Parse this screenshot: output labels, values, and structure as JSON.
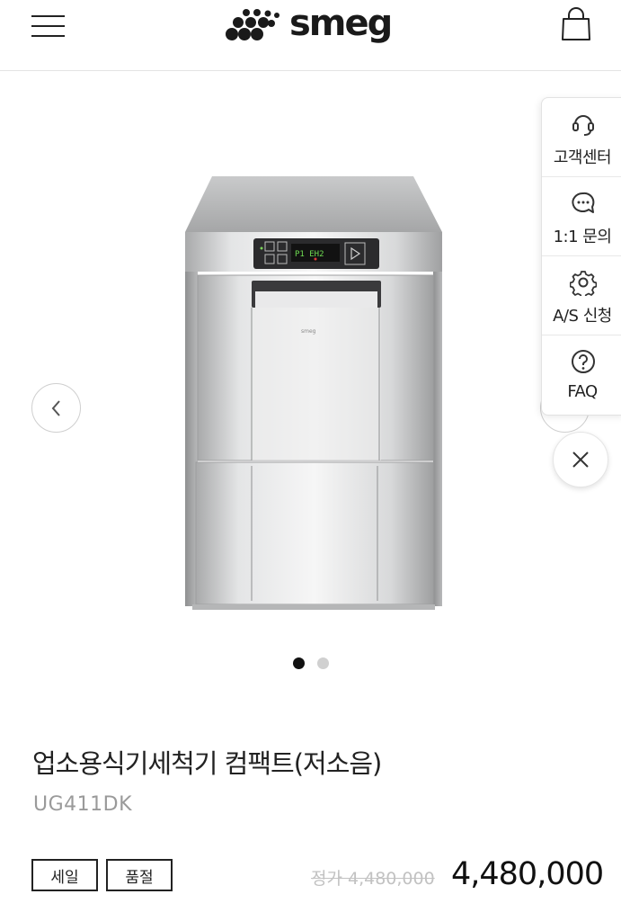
{
  "header": {
    "logo_text": "smeg",
    "menu_icon": "hamburger-menu-icon",
    "cart_icon": "shopping-bag-icon"
  },
  "gallery": {
    "slide_count": 2,
    "active_slide": 1,
    "image_brand_mark": "smeg"
  },
  "side_panel": {
    "items": [
      {
        "label": "고객센터",
        "icon": "headset-icon"
      },
      {
        "label": "1:1 문의",
        "icon": "chat-bubble-icon"
      },
      {
        "label": "A/S 신청",
        "icon": "gear-icon"
      },
      {
        "label": "FAQ",
        "icon": "question-circle-icon"
      }
    ],
    "close_icon": "close-icon"
  },
  "product": {
    "title": "업소용식기세척기 컴팩트(저소음)",
    "model": "UG411DK",
    "badges": [
      "세일",
      "품절"
    ],
    "original_price": "정가 4,480,000",
    "price": "4,480,000"
  },
  "colors": {
    "text": "#222222",
    "muted": "#9a9a9a",
    "strike_price": "#c2c2c2",
    "dot_active": "#111111",
    "dot_inactive": "#d0d0d0"
  }
}
